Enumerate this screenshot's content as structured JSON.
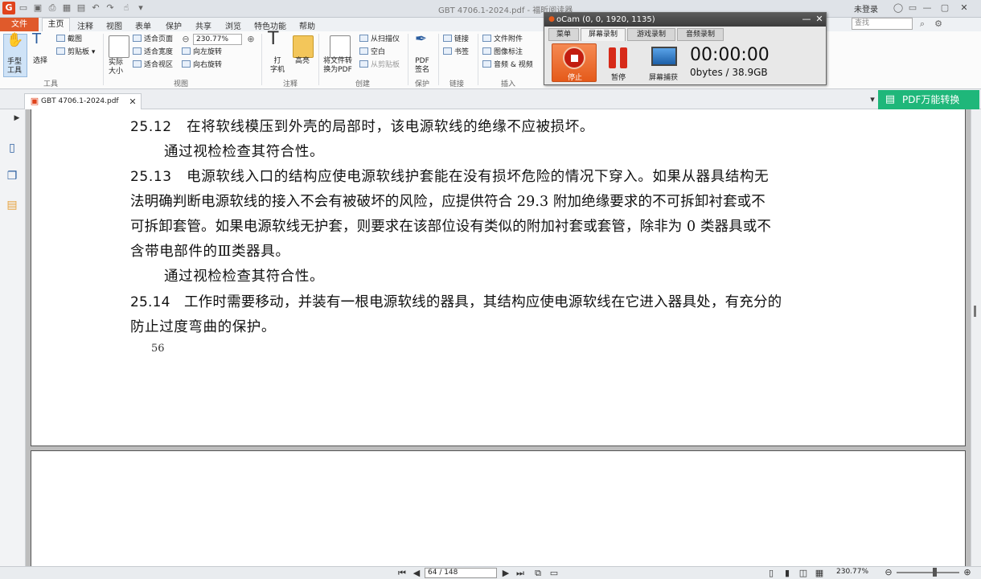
{
  "app": {
    "title": "GBT 4706.1-2024.pdf - 福昕阅读器",
    "login": "未登录",
    "search_placeholder": "查找"
  },
  "menu": {
    "file": "文件",
    "items": [
      "主页",
      "注释",
      "视图",
      "表单",
      "保护",
      "共享",
      "浏览",
      "特色功能",
      "帮助"
    ]
  },
  "ribbon": {
    "tools": {
      "hand": "手型\n工具",
      "select": "选择",
      "screenshot": "截图",
      "clipboard": "剪贴板",
      "group": "工具"
    },
    "view": {
      "actual": "实际\n大小",
      "fit_page": "适合页面",
      "fit_width": "适合宽度",
      "fit_view": "适合视区",
      "zoom": "230.77%",
      "rotate_left": "向左旋转",
      "rotate_right": "向右旋转",
      "group": "视图"
    },
    "comment": {
      "typewriter": "打\n字机",
      "highlight": "高亮",
      "group": "注释"
    },
    "create": {
      "convert": "将文件转\n换为PDF",
      "from_scanner": "从扫描仪",
      "blank": "空白",
      "from_clipboard": "从剪贴板",
      "group": "创建"
    },
    "protect": {
      "sign": "PDF\n签名",
      "group": "保护"
    },
    "links": {
      "link": "链接",
      "bookmark": "书签",
      "group": "链接"
    },
    "insert": {
      "attachment": "文件附件",
      "image_annot": "图像标注",
      "audio_video": "音频 & 视频",
      "group": "插入"
    }
  },
  "tab": {
    "filename": "GBT 4706.1-2024.pdf"
  },
  "convert_button": "PDF万能转换",
  "document": {
    "lines": [
      {
        "num": "25.12",
        "text": "在将软线模压到外壳的局部时，该电源软线的绝缘不应被损坏。"
      },
      {
        "num": "",
        "text": "通过视检检查其符合性。"
      },
      {
        "num": "25.13",
        "text": "电源软线入口的结构应使电源软线护套能在没有损坏危险的情况下穿入。如果从器具结构无"
      },
      {
        "num": "",
        "text": "法明确判断电源软线的接入不会有被破坏的风险，应提供符合 29.3 附加绝缘要求的不可拆卸衬套或不"
      },
      {
        "num": "",
        "text": "可拆卸套管。如果电源软线无护套，则要求在该部位设有类似的附加衬套或套管，除非为 0 类器具或不"
      },
      {
        "num": "",
        "text": "含带电部件的Ⅲ类器具。"
      },
      {
        "num": "",
        "text": "通过视检检查其符合性。"
      },
      {
        "num": "25.14",
        "text": "工作时需要移动，并装有一根电源软线的器具，其结构应使电源软线在它进入器具处，有充分的"
      },
      {
        "num": "",
        "text": "防止过度弯曲的保护。"
      }
    ],
    "page_number": "56"
  },
  "status": {
    "page": "64 / 148",
    "zoom": "230.77%"
  },
  "ocam": {
    "title": "oCam (0, 0, 1920, 1135)",
    "tabs": [
      "菜单",
      "屏幕录制",
      "游戏录制",
      "音频录制"
    ],
    "stop": "停止",
    "pause": "暂停",
    "capture": "屏幕捕获",
    "timer": "00:00:00",
    "size": "0bytes / 38.9GB"
  }
}
